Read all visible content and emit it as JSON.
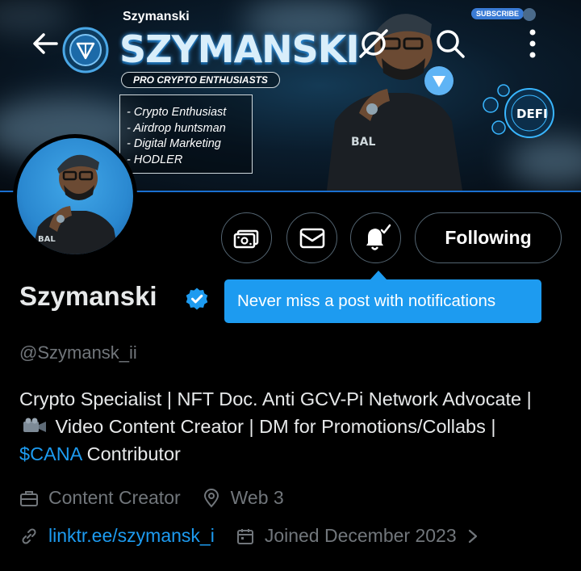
{
  "banner": {
    "small_title": "Szymanski",
    "title": "SZYMANSKI",
    "tagline": "PRO CRYPTO ENTHUSIASTS",
    "list": [
      "- Crypto Enthusiast",
      "- Airdrop huntsman",
      "- Digital Marketing",
      "- HODLER"
    ],
    "subscribe_label": "SUBSCRIBE",
    "defi_label": "DEFI"
  },
  "profile": {
    "display_name": "Szymanski",
    "handle": "@Szymansk_ii",
    "bio_part1": "Crypto Specialist | NFT Doc. Anti GCV-Pi Network Advocate | ",
    "bio_part2": " Video Content Creator | DM for Promotions/Collabs | ",
    "bio_cashtag": "$CANA",
    "bio_part3": " Contributor",
    "category": "Content Creator",
    "location": "Web 3",
    "website": "linktr.ee/szymansk_i",
    "joined": "Joined December 2023"
  },
  "actions": {
    "following_label": "Following"
  },
  "tooltip": {
    "text": "Never miss a post with notifications"
  },
  "colors": {
    "accent": "#1d9bf0",
    "secondary_text": "#71767b",
    "border": "#536471",
    "background": "#000000"
  },
  "icons": [
    "back-arrow-icon",
    "grok-icon",
    "search-icon",
    "more-vertical-icon",
    "subscription-money-icon",
    "mail-icon",
    "bell-subscribed-icon",
    "verified-badge-icon",
    "briefcase-icon",
    "location-pin-icon",
    "link-icon",
    "calendar-icon",
    "chevron-right-icon",
    "video-camera-emoji"
  ]
}
